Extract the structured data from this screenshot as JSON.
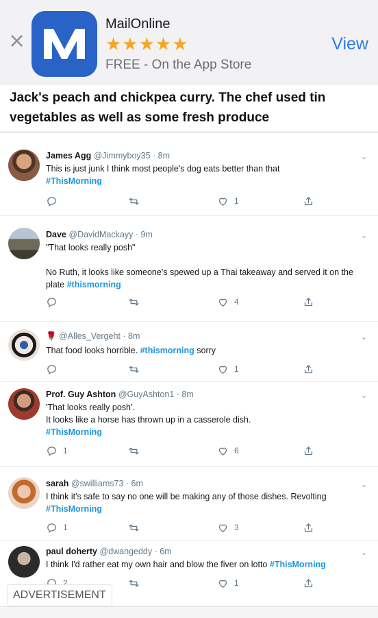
{
  "banner": {
    "close": "×",
    "app_name": "MailOnline",
    "rating_stars": "★★★★★",
    "store_line": "FREE - On the App Store",
    "view": "View"
  },
  "headline": "Jack's peach and chickpea curry. The chef used tin vegetables as well as some fresh produce",
  "tweets": [
    {
      "name": "James Agg",
      "handle": "@Jimmyboy35 · 8m",
      "text": "This is just junk I think most people's dog eats better than that",
      "hashtag": "#ThisMorning",
      "replies": "",
      "retweets": "",
      "likes": "1"
    },
    {
      "name": "Dave",
      "handle": "@DavidMackayy · 9m",
      "text_1": "\"That looks really posh\"",
      "text_2": "No Ruth, it looks like someone's spewed up a Thai takeaway and served it on the plate",
      "hashtag": "#thismorning",
      "replies": "",
      "retweets": "",
      "likes": "4"
    },
    {
      "name": "🌹",
      "handle": "@Alles_Vergeht · 8m",
      "text": "That food looks horrible.",
      "hashtag": "#thismorning",
      "text_after": "sorry",
      "replies": "",
      "retweets": "",
      "likes": "1"
    },
    {
      "name": "Prof. Guy Ashton",
      "handle": "@GuyAshton1 · 8m",
      "text_1": "'That looks really posh'.",
      "text_2": "It looks like a horse has thrown up in a casserole dish.",
      "hashtag": "#ThisMorning",
      "replies": "1",
      "retweets": "",
      "likes": "6"
    },
    {
      "name": "sarah",
      "handle": "@swilliams73 · 6m",
      "text": "I think it's safe to say no one will be making any of those dishes. Revolting",
      "hashtag": "#ThisMorning",
      "replies": "1",
      "retweets": "",
      "likes": "3"
    },
    {
      "name": "paul doherty",
      "handle": "@dwangeddy · 6m",
      "text": "I think I'd rather eat my own hair and blow the fiver on lotto",
      "hashtag": "#ThisMorning",
      "replies": "2",
      "retweets": "",
      "likes": "1"
    }
  ],
  "advertisement": "ADVERTISEMENT",
  "colors": {
    "banner_bg": "#f2f2f4",
    "app_icon": "#2a63c7",
    "stars": "#f5a623",
    "view": "#2f7ae5",
    "hashtag": "#1b95e0"
  }
}
